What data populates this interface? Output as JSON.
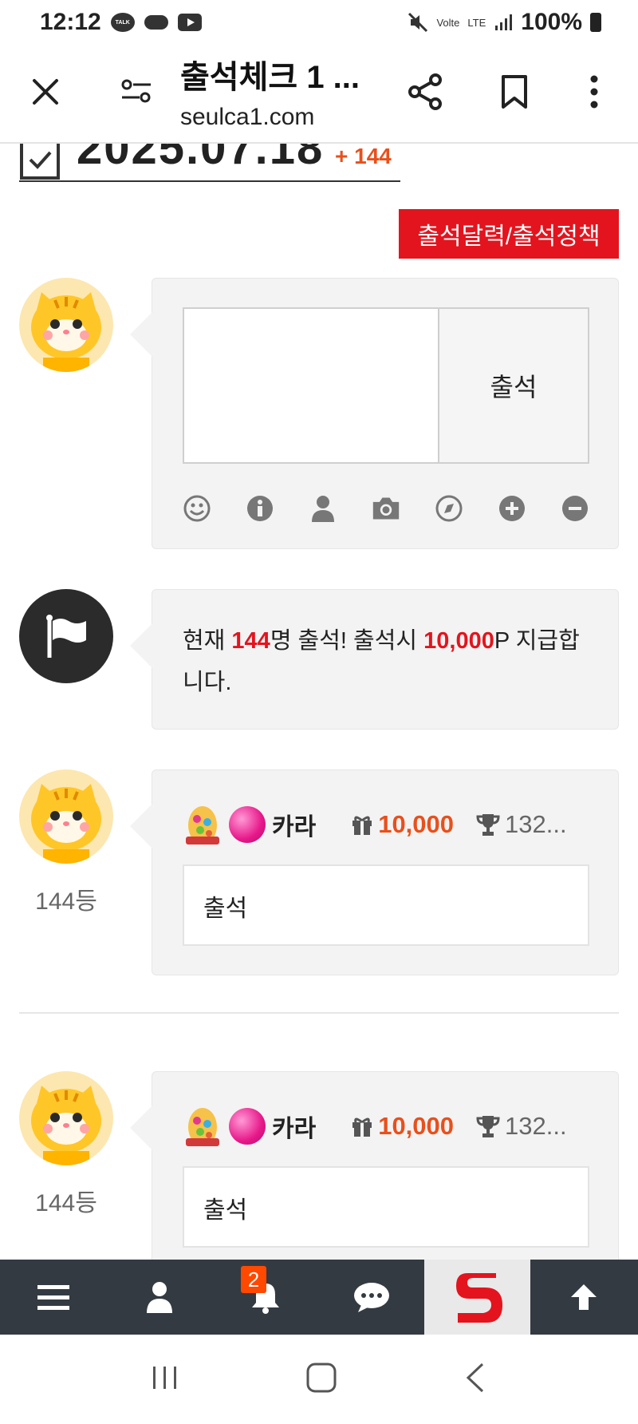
{
  "status_bar": {
    "time": "12:12",
    "talk_label": "TALK",
    "volte": "Volte",
    "lte": "LTE",
    "battery": "100%"
  },
  "browser": {
    "title": "출석체크 1 ...",
    "url": "seulca1.com"
  },
  "page": {
    "date": "2025.07.18",
    "date_delta": "+ 144",
    "policy_button": "출석달력/출석정책",
    "compose": {
      "submit_label": "출석",
      "textarea_placeholder": ""
    },
    "notice": {
      "prefix": "현재 ",
      "count": "144",
      "middle": "명 출석! 출석시 ",
      "points": "10,000",
      "suffix": "P 지급합니다."
    },
    "entries": [
      {
        "rank": "144등",
        "nickname": "카라",
        "points": "10,000",
        "trophy": "132...",
        "message": "출석"
      },
      {
        "rank": "144등",
        "nickname": "카라",
        "points": "10,000",
        "trophy": "132...",
        "message": "출석"
      }
    ]
  },
  "bottom_nav": {
    "notification_count": "2"
  },
  "colors": {
    "accent_red": "#e3141e",
    "points_orange": "#e8501c",
    "nav_bg": "#333a42"
  }
}
